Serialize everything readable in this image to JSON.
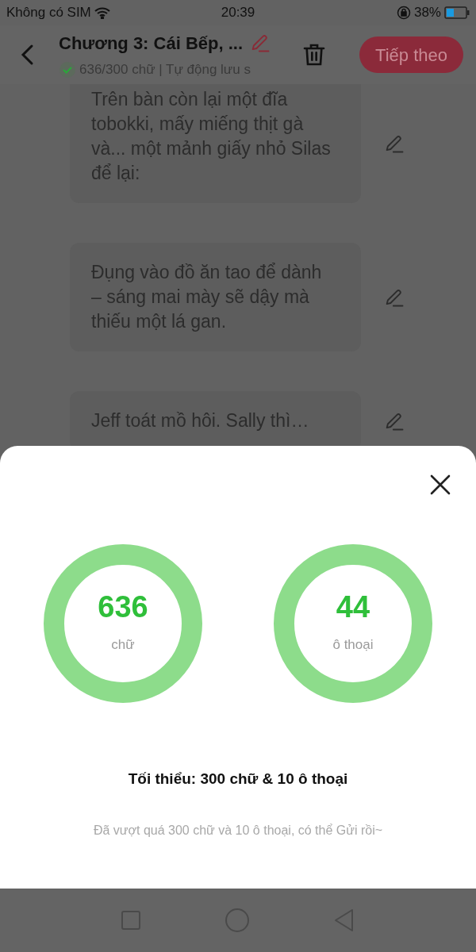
{
  "status_bar": {
    "carrier": "Không có SIM",
    "time": "20:39",
    "battery": "38%"
  },
  "header": {
    "title": "Chương 3: Cái Bếp, ...",
    "subtitle": "636/300 chữ | Tự động lưu s",
    "saved": true,
    "next_button": "Tiếp theo"
  },
  "paragraphs": [
    {
      "text": "Trên bàn còn lại một đĩa tobokki, mấy miếng thịt gà và... một mảnh giấy nhỏ Silas để lại:"
    },
    {
      "text": "Đụng vào đồ ăn tao để dành – sáng mai mày sẽ dậy mà thiếu một lá gan."
    },
    {
      "text": "Jeff toát mồ hôi. Sally thì…"
    }
  ],
  "sheet": {
    "stats": [
      {
        "value": "636",
        "label": "chữ"
      },
      {
        "value": "44",
        "label": "ô thoại"
      }
    ],
    "requirement": "Tối thiểu: 300 chữ & 10 ô thoại",
    "message": "Đã vượt quá 300 chữ và 10 ô thoại, có thể Gửi rồi~"
  }
}
